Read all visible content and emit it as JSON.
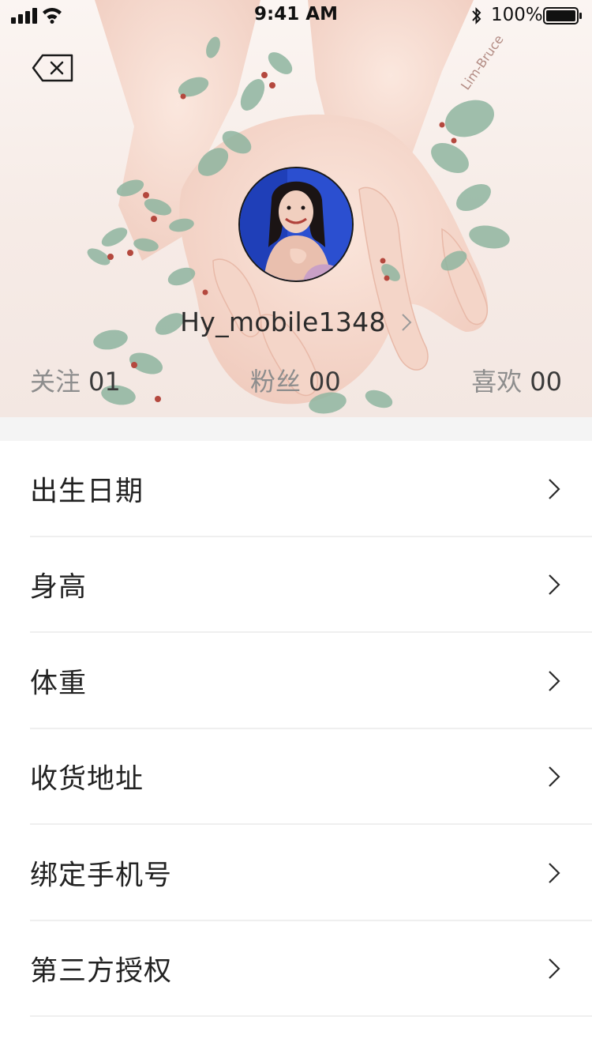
{
  "status_bar": {
    "time": "9:41 AM",
    "battery": "100%"
  },
  "header": {
    "back_icon": "backspace-close-icon",
    "username": "Hy_mobile1348",
    "signature": "Lim-Bruce"
  },
  "stats": [
    {
      "label": "关注",
      "value": "01"
    },
    {
      "label": "粉丝",
      "value": "00"
    },
    {
      "label": "喜欢",
      "value": "00"
    }
  ],
  "menu": {
    "items": [
      {
        "label": "出生日期"
      },
      {
        "label": "身高"
      },
      {
        "label": "体重"
      },
      {
        "label": "收货地址"
      },
      {
        "label": "绑定手机号"
      },
      {
        "label": "第三方授权"
      }
    ]
  },
  "colors": {
    "background": "#ffffff",
    "separator": "#f4f4f4",
    "stat_label": "#8d8d8d",
    "leaf": "#8fb5a0",
    "berry": "#b4483e",
    "skin": "#f2d3c6"
  }
}
